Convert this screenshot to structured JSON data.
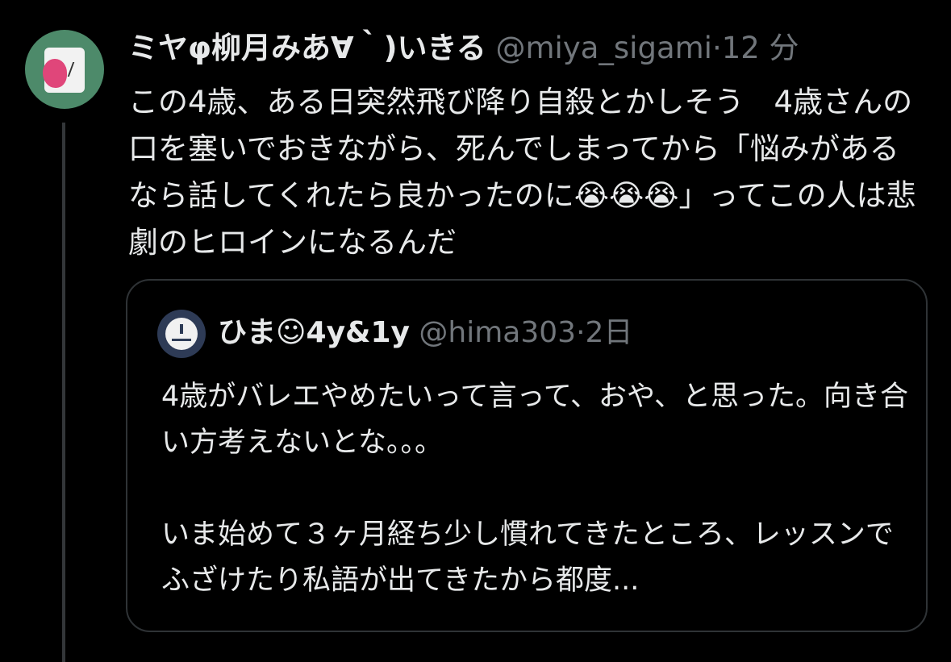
{
  "tweet": {
    "display_name": "ミヤφ柳月みあ∀｀)いきる",
    "handle": "@miya_sigami",
    "separator": "·",
    "time": "12 分",
    "text": "この4歳、ある日突然飛び降り自殺とかしそう　4歳さんの口を塞いでおきながら、死んでしまってから「悩みがあるなら話してくれたら良かったのに😭😭😭」ってこの人は悲劇のヒロインになるんだ"
  },
  "quote": {
    "display_name": "ひま☺4y&1y",
    "handle": "@hima303",
    "separator": "·",
    "time": "2日",
    "text": "4歳がバレエやめたいって言って、おや、と思った。向き合い方考えないとな。。。\n\nいま始めて３ヶ月経ち少し慣れてきたところ、レッスンでふざけたり私語が出てきたから都度..."
  },
  "colors": {
    "background": "#000000",
    "text_primary": "#e7e9ea",
    "text_secondary": "#71767b",
    "border": "#2f3336",
    "thread_line": "#333639"
  }
}
